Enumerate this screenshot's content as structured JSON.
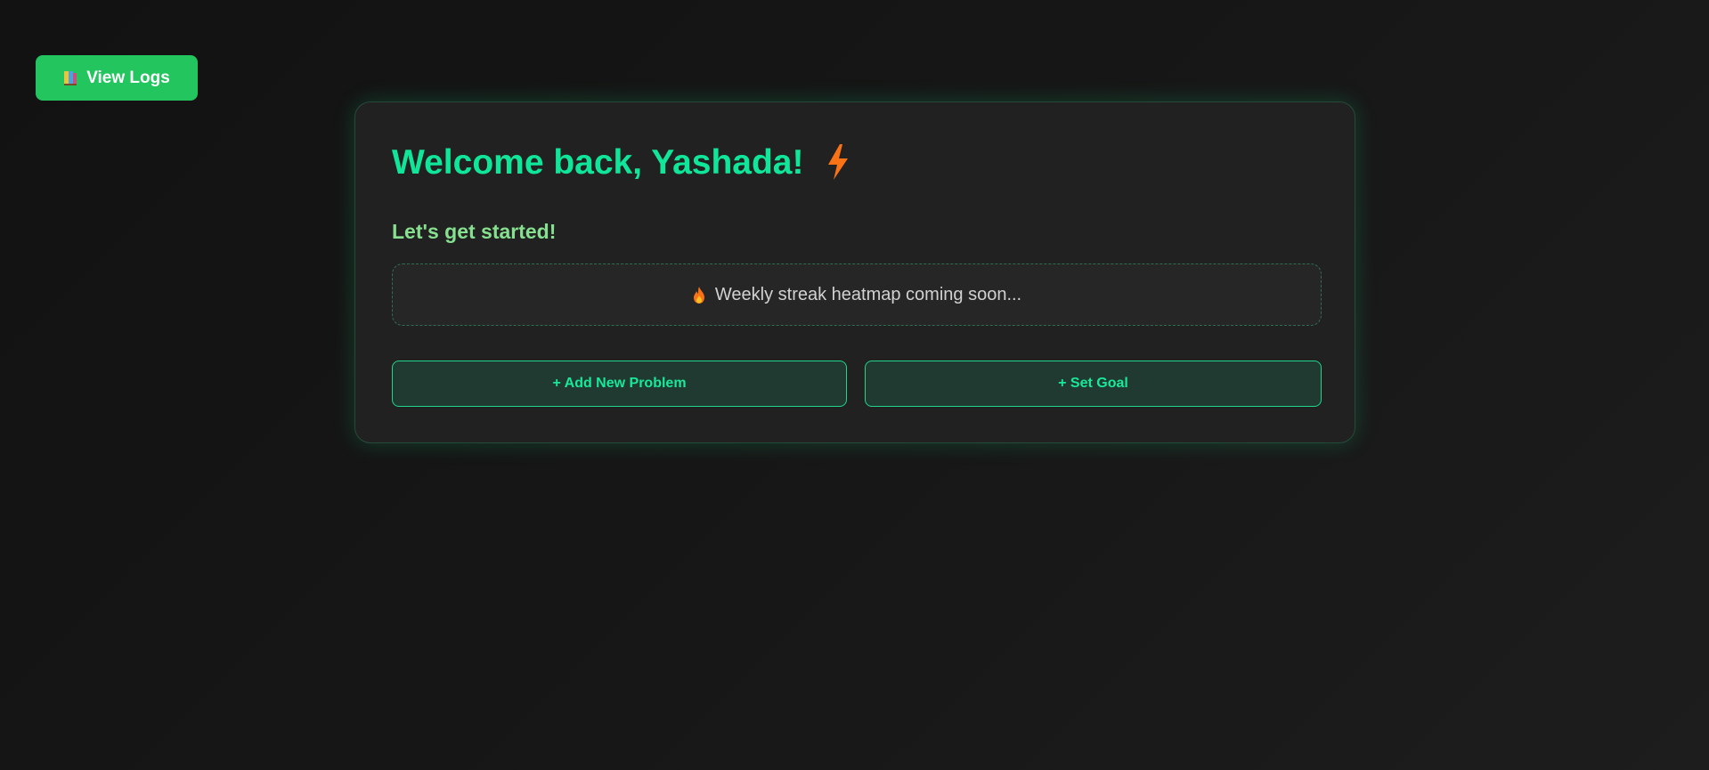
{
  "logs_button": {
    "label": "View Logs",
    "icon": "books-icon"
  },
  "welcome": {
    "title": "Welcome back, Yashada!",
    "icon": "lightning-bolt-icon",
    "subtitle": "Let's get started!"
  },
  "heatmap": {
    "icon": "fire-icon",
    "text": "Weekly streak heatmap coming soon..."
  },
  "actions": {
    "add_problem": "+ Add New Problem",
    "set_goal": "+ Set Goal"
  },
  "colors": {
    "accent": "#10e69a",
    "button_green": "#22c55e",
    "subtitle_green": "#86e08f",
    "bolt_orange": "#f97316"
  }
}
